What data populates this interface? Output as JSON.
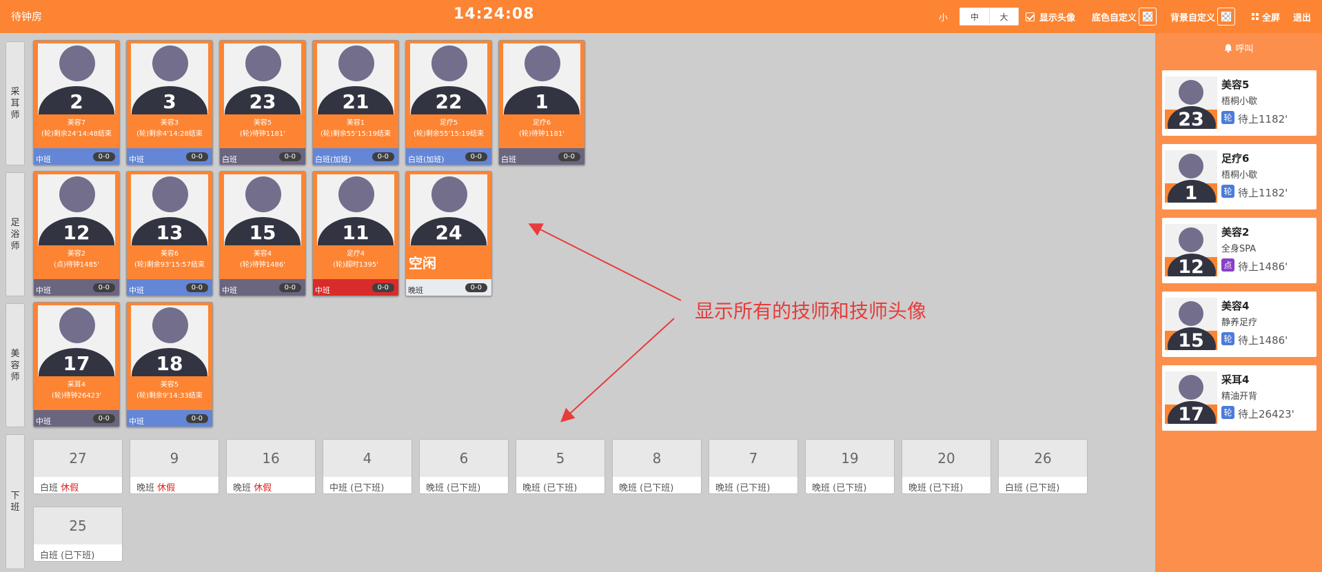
{
  "header": {
    "title": "待钟房",
    "clock": "14:24:08",
    "size_small": "小",
    "size_medium": "中",
    "size_large": "大",
    "show_avatar_label": "显示头像",
    "bottom_color_label": "底色自定义",
    "background_label": "背景自定义",
    "fullscreen_label": "全屏",
    "logout_label": "退出"
  },
  "groups": [
    {
      "label": "采耳师"
    },
    {
      "label": "足浴师"
    },
    {
      "label": "美容师"
    },
    {
      "label": "下班"
    }
  ],
  "techs": [
    {
      "num": "2",
      "project": "美容7",
      "status": "(轮)剩余24'14:48结束",
      "shift": "中班",
      "count": "0-0",
      "bar": "blue"
    },
    {
      "num": "3",
      "project": "美容3",
      "status": "(轮)剩余4'14:28结束",
      "shift": "中班",
      "count": "0-0",
      "bar": "blue"
    },
    {
      "num": "23",
      "project": "美容5",
      "status": "(轮)待钟1181'",
      "shift": "白班",
      "count": "0-0",
      "bar": "gray"
    },
    {
      "num": "21",
      "project": "美容1",
      "status": "(轮)剩余55'15:19结束",
      "shift": "白班(加班)",
      "count": "0-0",
      "bar": "blue"
    },
    {
      "num": "22",
      "project": "足疗5",
      "status": "(轮)剩余55'15:19结束",
      "shift": "白班(加班)",
      "count": "0-0",
      "bar": "blue"
    },
    {
      "num": "1",
      "project": "足疗6",
      "status": "(轮)待钟1181'",
      "shift": "白班",
      "count": "0-0",
      "bar": "gray"
    },
    {
      "num": "12",
      "project": "美容2",
      "status": "(点)待钟1485'",
      "shift": "中班",
      "count": "0-0",
      "bar": "gray"
    },
    {
      "num": "13",
      "project": "美容6",
      "status": "(轮)剩余93'15:57结束",
      "shift": "中班",
      "count": "0-0",
      "bar": "blue"
    },
    {
      "num": "15",
      "project": "美容4",
      "status": "(轮)待钟1486'",
      "shift": "中班",
      "count": "0-0",
      "bar": "gray"
    },
    {
      "num": "11",
      "project": "足疗4",
      "status": "(轮)超时1395'",
      "shift": "中班",
      "count": "0-0",
      "bar": "red"
    },
    {
      "num": "24",
      "project": "",
      "status": "",
      "idle": "空闲",
      "shift": "晚班",
      "count": "0-0",
      "bar": "light"
    },
    {
      "num": "17",
      "project": "采耳4",
      "status": "(轮)待钟26423'",
      "shift": "中班",
      "count": "0-0",
      "bar": "gray"
    },
    {
      "num": "18",
      "project": "美容5",
      "status": "(轮)剩余9'14:33结束",
      "shift": "中班",
      "count": "0-0",
      "bar": "blue"
    }
  ],
  "off_duty": [
    {
      "num": "27",
      "shift": "白班",
      "state": "休假",
      "leave": true
    },
    {
      "num": "9",
      "shift": "晚班",
      "state": "休假",
      "leave": true
    },
    {
      "num": "16",
      "shift": "晚班",
      "state": "休假",
      "leave": true
    },
    {
      "num": "4",
      "shift": "中班",
      "state": "(已下班)",
      "leave": false
    },
    {
      "num": "6",
      "shift": "晚班",
      "state": "(已下班)",
      "leave": false
    },
    {
      "num": "5",
      "shift": "晚班",
      "state": "(已下班)",
      "leave": false
    },
    {
      "num": "8",
      "shift": "晚班",
      "state": "(已下班)",
      "leave": false
    },
    {
      "num": "7",
      "shift": "晚班",
      "state": "(已下班)",
      "leave": false
    },
    {
      "num": "19",
      "shift": "晚班",
      "state": "(已下班)",
      "leave": false
    },
    {
      "num": "20",
      "shift": "晚班",
      "state": "(已下班)",
      "leave": false
    },
    {
      "num": "26",
      "shift": "白班",
      "state": "(已下班)",
      "leave": false
    },
    {
      "num": "25",
      "shift": "白班",
      "state": "(已下班)",
      "leave": false
    }
  ],
  "annotation": "显示所有的技师和技师头像",
  "right_panel": {
    "call_label": "呼叫",
    "waiting": [
      {
        "num": "23",
        "project": "美容5",
        "service": "梧桐小歇",
        "tag": "轮",
        "status": "待上1182'",
        "tag_color": "blue"
      },
      {
        "num": "1",
        "project": "足疗6",
        "service": "梧桐小歇",
        "tag": "轮",
        "status": "待上1182'",
        "tag_color": "blue"
      },
      {
        "num": "12",
        "project": "美容2",
        "service": "全身SPA",
        "tag": "点",
        "status": "待上1486'",
        "tag_color": "purple"
      },
      {
        "num": "15",
        "project": "美容4",
        "service": "静养足疗",
        "tag": "轮",
        "status": "待上1486'",
        "tag_color": "blue"
      },
      {
        "num": "17",
        "project": "采耳4",
        "service": "精油开背",
        "tag": "轮",
        "status": "待上26423'",
        "tag_color": "blue"
      }
    ]
  },
  "colors": {
    "accent": "#fd8432",
    "annotation": "#e83b3b",
    "bar_blue": "#6386d6",
    "bar_gray": "#6a6680",
    "bar_red": "#d92b2b"
  }
}
